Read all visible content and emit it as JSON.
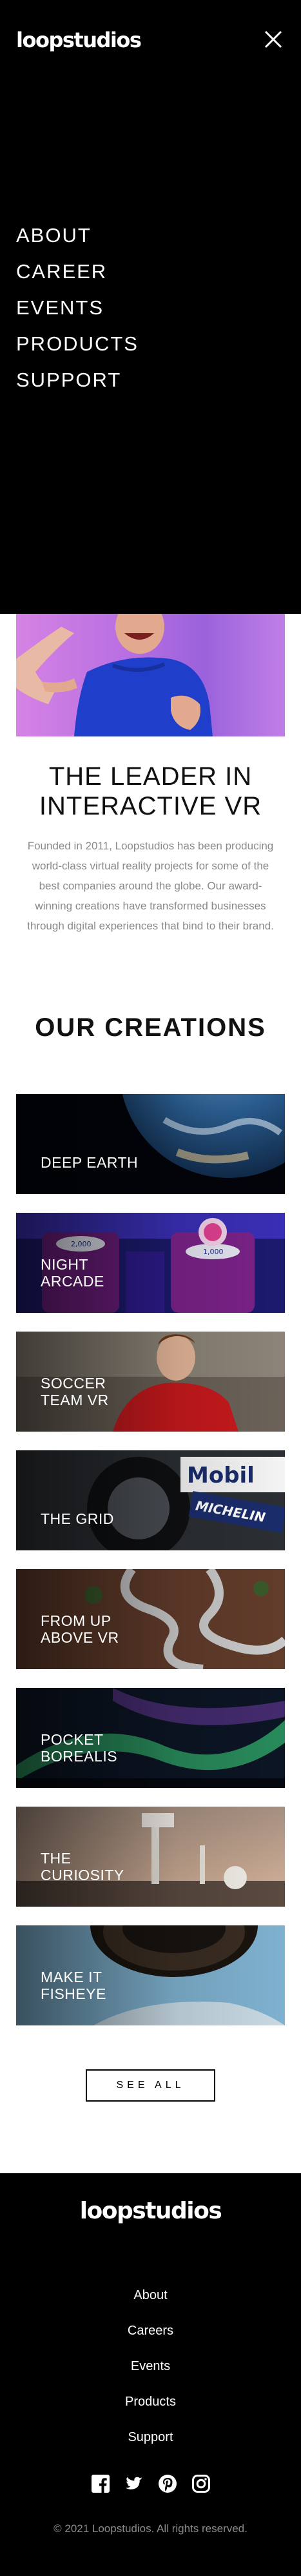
{
  "header": {
    "logo": "loopstudios",
    "close_icon": "close-icon"
  },
  "menu": {
    "items": [
      "About",
      "Career",
      "Events",
      "Products",
      "Support"
    ]
  },
  "leader": {
    "title": "The leader in interactive VR",
    "text": "Founded in 2011, Loopstudios has been producing world-class virtual reality projects for some of the best companies around the globe. Our award-winning creations have transformed businesses through digital experiences that bind to their brand."
  },
  "creations": {
    "title": "Our creations",
    "items": [
      {
        "label": "Deep earth",
        "image": "earth-from-space"
      },
      {
        "label": "Night arcade",
        "image": "arcade-machine"
      },
      {
        "label": "Soccer team VR",
        "image": "soccer-player"
      },
      {
        "label": "The grid",
        "image": "race-car-wheel"
      },
      {
        "label": "From up above VR",
        "image": "winding-road-aerial"
      },
      {
        "label": "Pocket borealis",
        "image": "northern-lights"
      },
      {
        "label": "The curiosity",
        "image": "mars-rover"
      },
      {
        "label": "Make it fisheye",
        "image": "fisheye-planet"
      }
    ],
    "see_all": "See all"
  },
  "footer": {
    "logo": "loopstudios",
    "nav": [
      "About",
      "Careers",
      "Events",
      "Products",
      "Support"
    ],
    "socials": [
      "facebook-icon",
      "twitter-icon",
      "pinterest-icon",
      "instagram-icon"
    ],
    "copyright": "© 2021 Loopstudios. All rights reserved."
  }
}
